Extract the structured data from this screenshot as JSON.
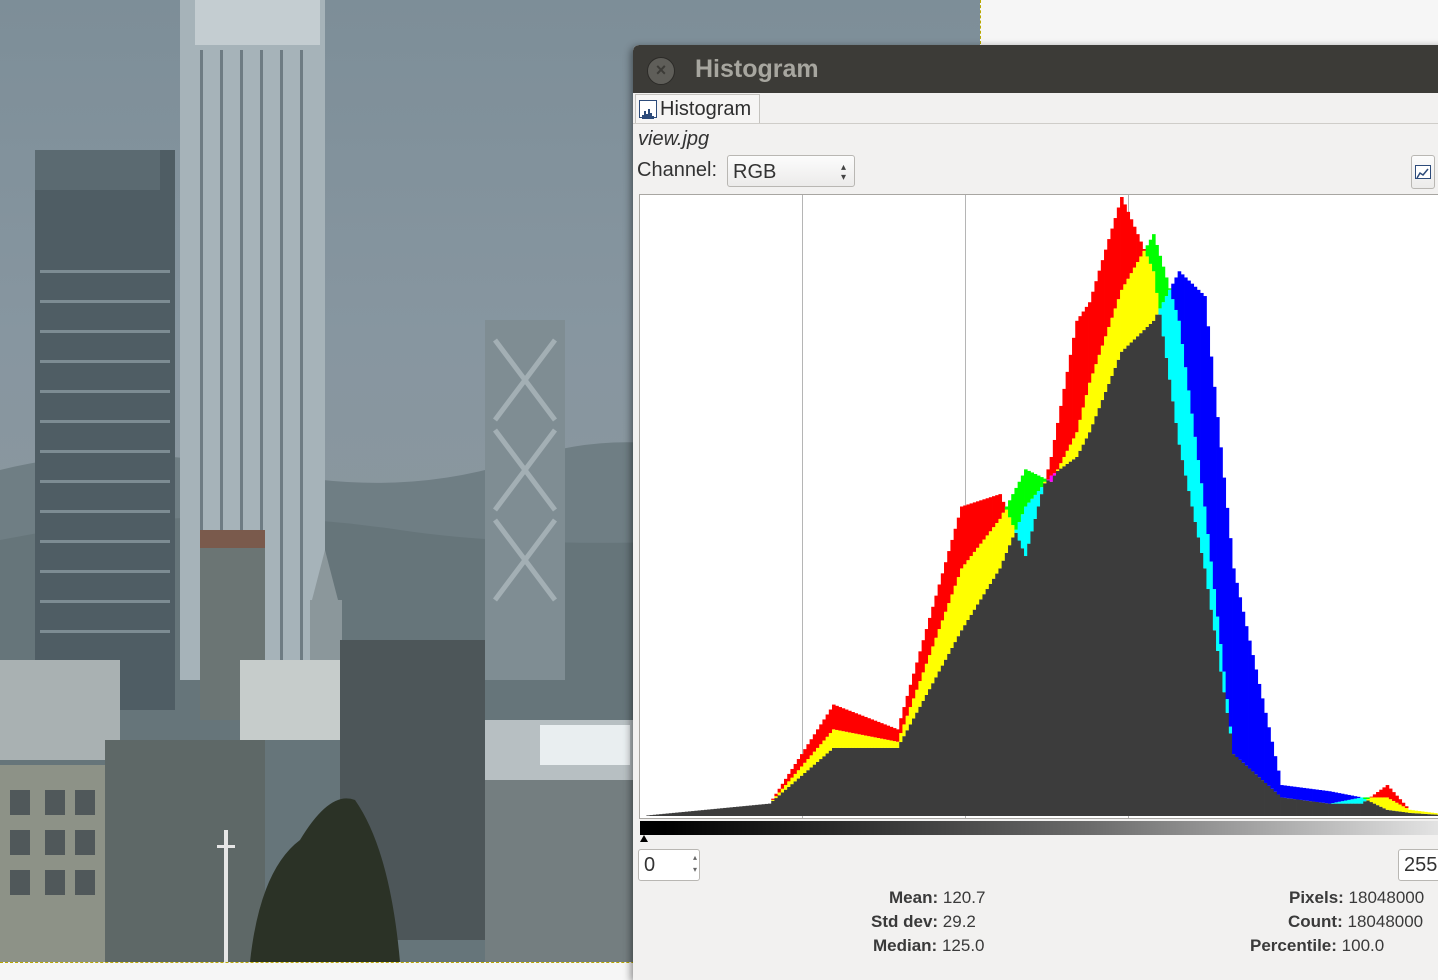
{
  "dialog": {
    "title": "Histogram",
    "tab_label": "Histogram",
    "filename": "view.jpg",
    "channel_label": "Channel:",
    "channel_value": "RGB",
    "range_start": "0",
    "range_end": "255"
  },
  "stats": {
    "mean_label": "Mean:",
    "mean_value": "120.7",
    "stddev_label": "Std dev:",
    "stddev_value": "29.2",
    "median_label": "Median:",
    "median_value": "125.0",
    "pixels_label": "Pixels:",
    "pixels_value": "18048000",
    "count_label": "Count:",
    "count_value": "18048000",
    "percentile_label": "Percentile:",
    "percentile_value": "100.0"
  },
  "icons": {
    "close": "close-icon",
    "tab": "histogram-icon",
    "scale": "linear-scale-icon"
  },
  "colors": {
    "titlebar": "#3c3b37",
    "red": "#ff0000",
    "yellow": "#ffff00",
    "green": "#00ff00",
    "cyan": "#00ffff",
    "blue": "#0000ff",
    "magenta": "#ff00ff",
    "overlap": "#3c3c3c"
  },
  "chart_data": {
    "type": "area",
    "x_range": [
      0,
      255
    ],
    "grid": "vertical",
    "series": [
      {
        "channel": "red",
        "x": [
          0,
          40,
          60,
          80,
          100,
          112,
          120,
          128,
          136,
          140,
          150,
          160,
          168,
          176,
          185,
          200,
          215,
          225,
          233,
          240,
          255
        ],
        "y": [
          0,
          0.02,
          0.18,
          0.14,
          0.5,
          0.52,
          0.42,
          0.58,
          0.8,
          0.83,
          1.0,
          0.88,
          0.6,
          0.4,
          0.1,
          0.03,
          0.02,
          0.02,
          0.05,
          0.01,
          0
        ]
      },
      {
        "channel": "green",
        "x": [
          0,
          40,
          60,
          80,
          100,
          112,
          120,
          128,
          136,
          140,
          150,
          160,
          168,
          176,
          185,
          200,
          215,
          225,
          233,
          240,
          255
        ],
        "y": [
          0,
          0.02,
          0.14,
          0.12,
          0.4,
          0.48,
          0.56,
          0.54,
          0.62,
          0.7,
          0.85,
          0.94,
          0.8,
          0.5,
          0.1,
          0.03,
          0.02,
          0.03,
          0.03,
          0.01,
          0
        ]
      },
      {
        "channel": "blue",
        "x": [
          0,
          40,
          60,
          80,
          100,
          112,
          120,
          128,
          136,
          140,
          150,
          160,
          168,
          176,
          185,
          200,
          215,
          225,
          233,
          240,
          255
        ],
        "y": [
          0,
          0.02,
          0.11,
          0.11,
          0.3,
          0.4,
          0.5,
          0.55,
          0.58,
          0.62,
          0.75,
          0.8,
          0.88,
          0.84,
          0.4,
          0.05,
          0.04,
          0.03,
          0.01,
          0.005,
          0
        ]
      }
    ]
  }
}
